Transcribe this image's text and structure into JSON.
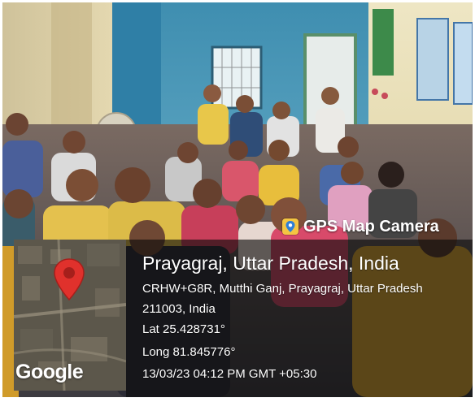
{
  "overlay": {
    "app_name": "GPS Map Camera",
    "place": "Prayagraj, Uttar Pradesh, India",
    "address_line1": "CRHW+G8R, Mutthi Ganj, Prayagraj, Uttar Pradesh",
    "address_line2": "211003, India",
    "latitude": "Lat 25.428731°",
    "longitude": "Long 81.845776°",
    "timestamp": "13/03/23 04:12 PM GMT +05:30"
  },
  "map": {
    "brand": "Google"
  },
  "colors": {
    "wall_blue": "#4f9bbb",
    "wall_cream": "#e6dcb2",
    "pin_red": "#e0312c",
    "panel_dark": "#1a1a1a"
  }
}
